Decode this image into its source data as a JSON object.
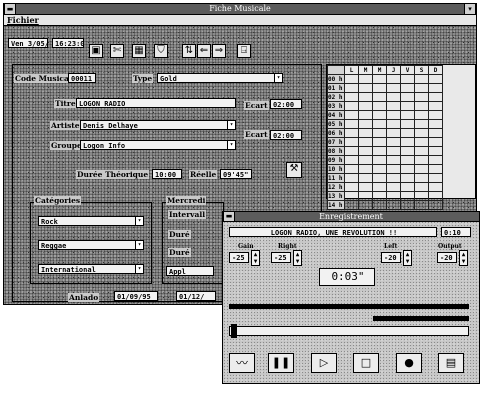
{
  "main_window": {
    "title": "Fiche Musicale",
    "menu": {
      "fichier": "Fichier"
    },
    "toolbar": {
      "date": "Ven 3/05/96",
      "time": "16:23:03"
    },
    "form": {
      "code_label": "Code Musical",
      "code_value": "00011",
      "type_label": "Type",
      "type_value": "Gold",
      "titre_label": "Titre",
      "titre_value": "LOGON RADIO",
      "ecart_label": "Ecart",
      "ecart1_value": "02:00",
      "artiste_label": "Artiste",
      "artiste_value": "Denis Delhaye",
      "ecart2_value": "02:00",
      "groupe_label": "Groupe",
      "groupe_value": "Logon Info",
      "duree_label": "Durée Théorique",
      "duree_value": "10:00",
      "reelle_label": "Réelle",
      "reelle_value": "09'45\"",
      "categories_label": "Catégories",
      "cat1": "Rock",
      "cat2": "Reggae",
      "cat3": "International",
      "mercredi_label": "Mercredi",
      "intervalle_label": "Intervall",
      "dure_label1": "Duré",
      "dure_label2": "Duré",
      "app_value": "Appl",
      "diffusion_label": "Anlado",
      "diffusion_value1": "01/09/95",
      "diffusion_value2": "01/12/"
    },
    "grid": {
      "days": [
        "L",
        "M",
        "M",
        "J",
        "V",
        "S",
        "D"
      ],
      "hours": [
        "00 h",
        "01 h",
        "02 h",
        "03 h",
        "04 h",
        "05 h",
        "06 h",
        "07 h",
        "08 h",
        "09 h",
        "10 h",
        "11 h",
        "12 h",
        "13 h",
        "14 h"
      ]
    }
  },
  "recorder": {
    "title": "Enregistrement",
    "track": "LOGON RADIO, UNE REVOLUTION !!",
    "track_time": "0:10",
    "gain_label": "Gain",
    "right_label": "Right",
    "left_label": "Left",
    "output_label": "Output",
    "v1": "-25",
    "v2": "-25",
    "v3": "-20",
    "v4": "-20",
    "elapsed": "0:03\""
  },
  "colors": {
    "titlebar": "#5c5c5c",
    "window_bg": "#8a8a8a",
    "field_bg": "#f2f2f2"
  }
}
